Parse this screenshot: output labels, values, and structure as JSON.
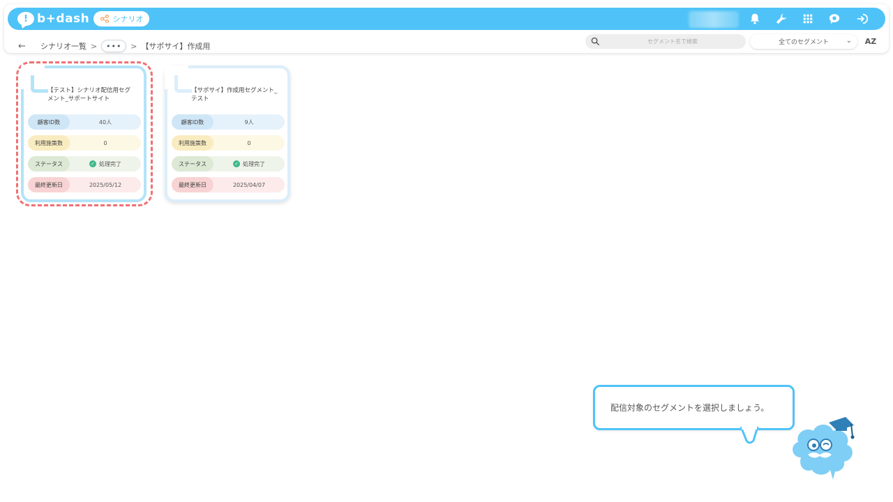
{
  "header": {
    "logo_text": "b+dash",
    "scenario_label": "シナリオ",
    "brand_color": "#4fc3f7",
    "icons": [
      "bell-icon",
      "wrench-icon",
      "grid-icon",
      "chat-avatar-icon",
      "logout-icon"
    ]
  },
  "breadcrumb": {
    "items": [
      "シナリオ一覧",
      "•••",
      "【サポサイ】作成用"
    ],
    "separator": ">"
  },
  "toolbar": {
    "search_placeholder": "セグメント名で検索",
    "filter_selected": "全てのセグメント",
    "sort_label": "AZ"
  },
  "row_labels": {
    "customers": "顧客ID数",
    "used": "利用施策数",
    "status": "ステータス",
    "updated": "最終更新日"
  },
  "segments": [
    {
      "title": "【テスト】シナリオ配信用セグメント_サポートサイト",
      "customers": "40人",
      "used": "0",
      "status": "処理完了",
      "updated": "2025/05/12"
    },
    {
      "title": "【サポサイ】作成用セグメント_テスト",
      "customers": "9人",
      "used": "0",
      "status": "処理完了",
      "updated": "2025/04/07"
    }
  ],
  "guide": {
    "message": "配信対象のセグメントを選択しましょう。"
  }
}
